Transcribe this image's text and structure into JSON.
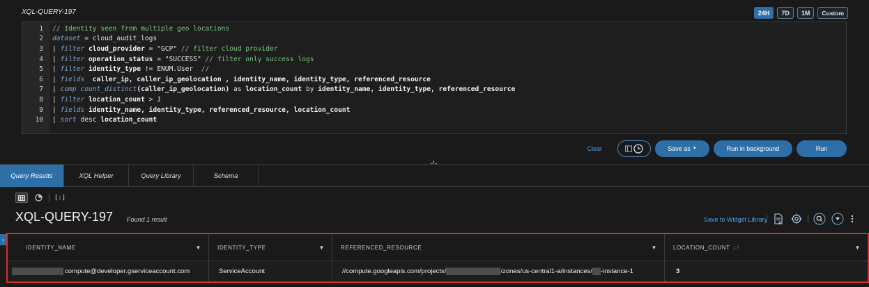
{
  "query_title": "XQL-QUERY-197",
  "time_ranges": [
    "24H",
    "7D",
    "1M",
    "Custom"
  ],
  "editor": {
    "lines": [
      {
        "n": "1",
        "parts": [
          {
            "t": "// Identity seen from multiple geo locations",
            "c": "c-comment"
          }
        ]
      },
      {
        "n": "2",
        "parts": [
          {
            "t": "dataset",
            "c": "c-kw"
          },
          {
            "t": " = cloud_audit_logs",
            "c": "c-plain"
          }
        ]
      },
      {
        "n": "3",
        "parts": [
          {
            "t": "| ",
            "c": "c-plain"
          },
          {
            "t": "filter",
            "c": "c-kw"
          },
          {
            "t": " cloud_provider",
            "c": "c-field"
          },
          {
            "t": " = \"GCP\" ",
            "c": "c-str"
          },
          {
            "t": "// filter cloud provider",
            "c": "c-comment"
          }
        ]
      },
      {
        "n": "4",
        "parts": [
          {
            "t": "| ",
            "c": "c-plain"
          },
          {
            "t": "filter",
            "c": "c-kw"
          },
          {
            "t": " operation_status",
            "c": "c-field"
          },
          {
            "t": " = \"SUCCESS\" ",
            "c": "c-str"
          },
          {
            "t": "// filter only success logs",
            "c": "c-comment"
          }
        ]
      },
      {
        "n": "5",
        "parts": [
          {
            "t": "| ",
            "c": "c-plain"
          },
          {
            "t": "filter",
            "c": "c-kw"
          },
          {
            "t": " identity_type",
            "c": "c-field"
          },
          {
            "t": " != ENUM.User  ",
            "c": "c-plain"
          },
          {
            "t": "//",
            "c": "c-comment"
          }
        ]
      },
      {
        "n": "6",
        "parts": [
          {
            "t": "| ",
            "c": "c-plain"
          },
          {
            "t": "fields",
            "c": "c-kw"
          },
          {
            "t": "  caller_ip, caller_ip_geolocation , identity_name, identity_type, referenced_resource",
            "c": "c-field"
          }
        ]
      },
      {
        "n": "7",
        "parts": [
          {
            "t": "| ",
            "c": "c-plain"
          },
          {
            "t": "comp",
            "c": "c-kw"
          },
          {
            "t": " ",
            "c": "c-plain"
          },
          {
            "t": "count_distinct",
            "c": "c-kw"
          },
          {
            "t": "(caller_ip_geolocation)",
            "c": "c-field"
          },
          {
            "t": " as ",
            "c": "c-plain"
          },
          {
            "t": "location_count",
            "c": "c-field"
          },
          {
            "t": " by ",
            "c": "c-plain"
          },
          {
            "t": "identity_name, identity_type, referenced_resource",
            "c": "c-field"
          }
        ]
      },
      {
        "n": "8",
        "parts": [
          {
            "t": "| ",
            "c": "c-plain"
          },
          {
            "t": "filter",
            "c": "c-kw"
          },
          {
            "t": " location_count",
            "c": "c-field"
          },
          {
            "t": " > ",
            "c": "c-plain"
          },
          {
            "t": "1",
            "c": "c-num"
          }
        ]
      },
      {
        "n": "9",
        "parts": [
          {
            "t": "| ",
            "c": "c-plain"
          },
          {
            "t": "fields",
            "c": "c-kw"
          },
          {
            "t": " identity_name, identity_type, referenced_resource, location_count",
            "c": "c-field"
          }
        ]
      },
      {
        "n": "10",
        "parts": [
          {
            "t": "| ",
            "c": "c-plain"
          },
          {
            "t": "sort",
            "c": "c-kw"
          },
          {
            "t": " desc ",
            "c": "c-plain"
          },
          {
            "t": "location_count",
            "c": "c-field"
          }
        ]
      }
    ]
  },
  "actions": {
    "clear": "Clear",
    "save_as": "Save as",
    "run_background": "Run in background",
    "run": "Run"
  },
  "tabs": [
    "Query Results",
    "XQL Helper",
    "Query Library",
    "Schema"
  ],
  "results": {
    "title": "XQL-QUERY-197",
    "found": "Found 1 result",
    "save_widget": "Save to Widget Library"
  },
  "table": {
    "columns": [
      "IDENTITY_NAME",
      "IDENTITY_TYPE",
      "REFERENCED_RESOURCE",
      "LOCATION_COUNT"
    ],
    "row": {
      "identity_name": "compute@developer.gserviceaccount.com",
      "identity_type": "ServiceAccount",
      "ref_a": "//compute.googleapis.com/projects/",
      "ref_b": "/zones/us-central1-a/instances/",
      "ref_c": "-instance-1",
      "location_count": "3"
    }
  },
  "colors": {
    "accent": "#2f6fa8",
    "highlight_border": "#d9302a",
    "link": "#4fa3e8"
  }
}
